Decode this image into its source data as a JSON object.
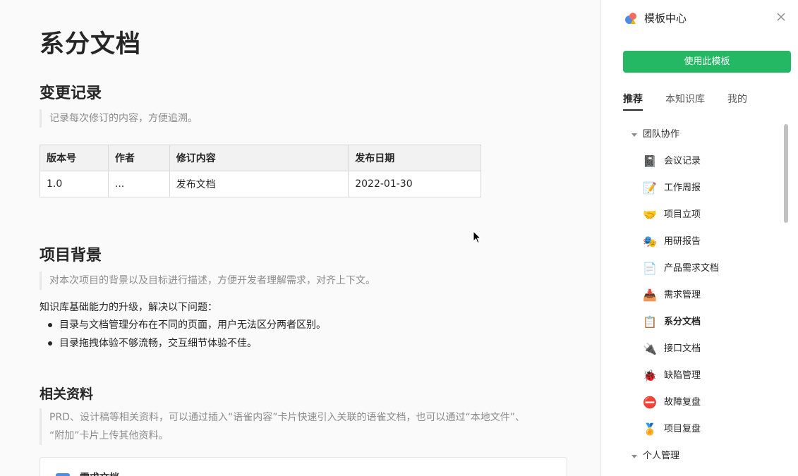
{
  "doc": {
    "title": "系分文档",
    "sections": {
      "changelog": {
        "heading": "变更记录",
        "quote": "记录每次修订的内容，方便追溯。",
        "table": {
          "headers": [
            "版本号",
            "作者",
            "修订内容",
            "发布日期"
          ],
          "rows": [
            [
              "1.0",
              "...",
              "发布文档",
              "2022-01-30"
            ]
          ]
        }
      },
      "background": {
        "heading": "项目背景",
        "quote": "对本次项目的背景以及目标进行描述，方便开发者理解需求，对齐上下文。",
        "intro": "知识库基础能力的升级，解决以下问题：",
        "bullets": [
          "目录与文档管理分布在不同的页面，用户无法区分两者区别。",
          "目录拖拽体验不够流畅，交互细节体验不佳。"
        ]
      },
      "materials": {
        "heading": "相关资料",
        "quote_line1": "PRD、设计稿等相关资料，可以通过插入“语雀内容”卡片快速引入关联的语雀文档，也可以通过“本地文件”、",
        "quote_line2": "“附加”卡片上传其他资料。",
        "card_label": "需求文档"
      }
    }
  },
  "panel": {
    "title": "模板中心",
    "use_button": "使用此模板",
    "tabs": [
      "推荐",
      "本知识库",
      "我的"
    ],
    "active_tab": 0,
    "groups": [
      {
        "label": "团队协作",
        "items": [
          {
            "label": "会议记录",
            "icon": "notebook-icon",
            "glyph": "📓"
          },
          {
            "label": "工作周报",
            "icon": "memo-icon",
            "glyph": "📝"
          },
          {
            "label": "项目立项",
            "icon": "handshake-icon",
            "glyph": "🤝"
          },
          {
            "label": "用研报告",
            "icon": "masks-icon",
            "glyph": "🎭"
          },
          {
            "label": "产品需求文档",
            "icon": "document-icon",
            "glyph": "📄"
          },
          {
            "label": "需求管理",
            "icon": "inbox-tray-icon",
            "glyph": "📥"
          },
          {
            "label": "系分文档",
            "icon": "clipboard-icon",
            "glyph": "📋",
            "selected": true
          },
          {
            "label": "接口文档",
            "icon": "plug-icon",
            "glyph": "🔌"
          },
          {
            "label": "缺陷管理",
            "icon": "ladybug-icon",
            "glyph": "🐞"
          },
          {
            "label": "故障复盘",
            "icon": "no-entry-icon",
            "glyph": "⛔"
          },
          {
            "label": "项目复盘",
            "icon": "medal-icon",
            "glyph": "🏅"
          }
        ]
      },
      {
        "label": "个人管理",
        "items": []
      }
    ]
  },
  "colors": {
    "primary_button": "#25b864",
    "text": "#262626",
    "muted": "#8c8c8c"
  }
}
